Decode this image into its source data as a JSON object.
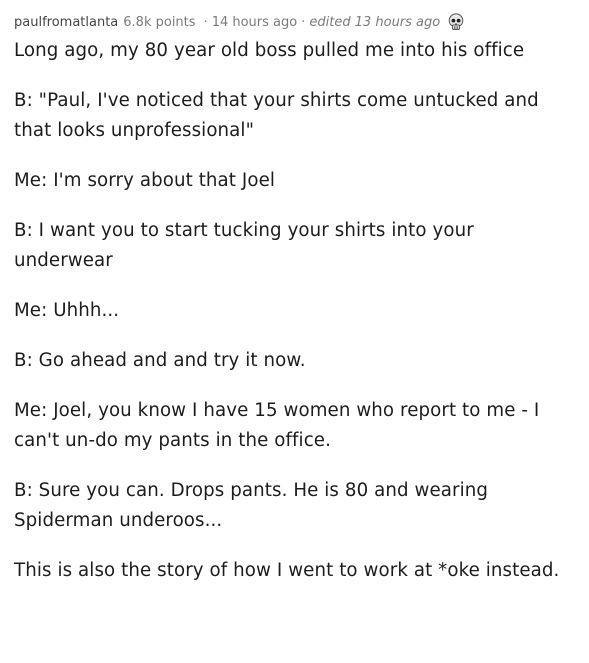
{
  "comment": {
    "author": "paulfromatlanta",
    "points": "6.8k points",
    "separator": "·",
    "time": "14 hours ago",
    "edited": "edited 13 hours ago",
    "award_icon": "skull-award-icon",
    "paragraphs": [
      "Long ago, my 80 year old boss pulled me into his office",
      "B: \"Paul, I've noticed that your shirts come untucked and that looks unprofessional\"",
      "Me: I'm sorry about that Joel",
      "B: I want you to start tucking your shirts into your underwear",
      "Me: Uhhh...",
      "B: Go ahead and and try it now.",
      "Me: Joel, you know I have 15 women who report to me - I can't un-do my pants in the office.",
      "B: Sure you can. Drops pants. He is 80 and wearing Spiderman underoos...",
      "This is also the story of how I went to work at *oke instead."
    ]
  }
}
